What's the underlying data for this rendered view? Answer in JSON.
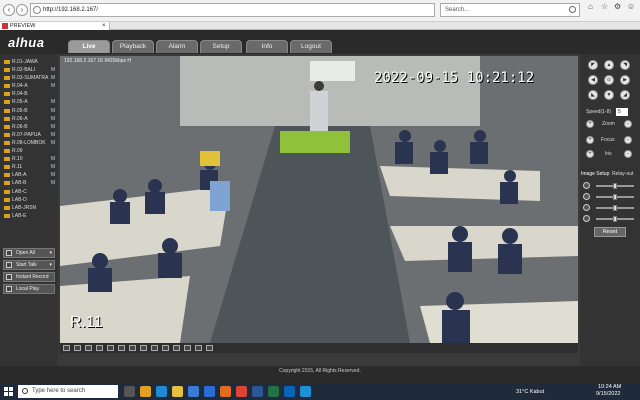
{
  "browser": {
    "address": "http://192.168.2.167/",
    "search_placeholder": "Search...",
    "tab_label": "PREVIEW",
    "tab_close": "×",
    "back": "‹",
    "forward": "›"
  },
  "app": {
    "logo": "alhua",
    "tabs": [
      "Live",
      "Playback",
      "Alarm",
      "Setup",
      "Info",
      "Logout"
    ],
    "active_tab": "Live"
  },
  "channels": [
    {
      "name": "R.01-JAWA",
      "m": ""
    },
    {
      "name": "R.02-BALI",
      "m": "M"
    },
    {
      "name": "R.03-SUMATRA",
      "m": "M"
    },
    {
      "name": "R.04-A",
      "m": "M"
    },
    {
      "name": "R.04-B",
      "m": ""
    },
    {
      "name": "R.05-A",
      "m": "M"
    },
    {
      "name": "R.05-B",
      "m": "M"
    },
    {
      "name": "R.06-A",
      "m": "M"
    },
    {
      "name": "R.06-B",
      "m": "M"
    },
    {
      "name": "R.07-PAPUA",
      "m": "M"
    },
    {
      "name": "R.08-LOMBOK",
      "m": "M"
    },
    {
      "name": "R.09",
      "m": ""
    },
    {
      "name": "R.10",
      "m": "M"
    },
    {
      "name": "R.11",
      "m": "M"
    },
    {
      "name": "LAB-A",
      "m": "M"
    },
    {
      "name": "LAB-B",
      "m": "M"
    },
    {
      "name": "LAB-C",
      "m": ""
    },
    {
      "name": "LAB-D",
      "m": ""
    },
    {
      "name": "LAB-JRSN",
      "m": ""
    },
    {
      "name": "LAB-E",
      "m": ""
    }
  ],
  "left_buttons": {
    "open_all": "Open All",
    "start_talk": "Start Talk",
    "instant_record": "Instant Record",
    "local_play": "Local Play",
    "dropdown": "▾"
  },
  "video": {
    "stream_info": "192.168.2.167 16 9420kbps H",
    "timestamp": "2022-09-15 10:21:12",
    "camera_label": "R.11"
  },
  "ptz": {
    "arrows": [
      "◤",
      "▲",
      "◥",
      "◀",
      "⊙",
      "▶",
      "◣",
      "▼",
      "◢"
    ],
    "speed_label": "Speed(1-8)",
    "speed_value": "5",
    "zoom": "Zoom",
    "focus": "Focus",
    "iris": "Iris",
    "plus": "+",
    "minus": "-",
    "image_setup": "Image Setup",
    "relay_out": "Relay-out",
    "reset": "Reset",
    "sliders": [
      0.5,
      0.5,
      0.5,
      0.5
    ]
  },
  "footer": {
    "copyright": "Copyright 2015, All Rights Reserved."
  },
  "taskbar": {
    "search_placeholder": "Type here to search",
    "weather": "31°C  Kabut",
    "time": "10:24 AM",
    "date": "9/15/2022"
  }
}
